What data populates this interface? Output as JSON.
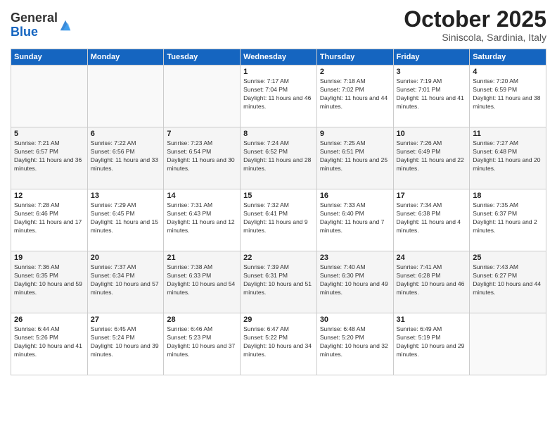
{
  "logo": {
    "general": "General",
    "blue": "Blue"
  },
  "header": {
    "month": "October 2025",
    "location": "Siniscola, Sardinia, Italy"
  },
  "days_of_week": [
    "Sunday",
    "Monday",
    "Tuesday",
    "Wednesday",
    "Thursday",
    "Friday",
    "Saturday"
  ],
  "weeks": [
    [
      {
        "day": "",
        "info": ""
      },
      {
        "day": "",
        "info": ""
      },
      {
        "day": "",
        "info": ""
      },
      {
        "day": "1",
        "info": "Sunrise: 7:17 AM\nSunset: 7:04 PM\nDaylight: 11 hours and 46 minutes."
      },
      {
        "day": "2",
        "info": "Sunrise: 7:18 AM\nSunset: 7:02 PM\nDaylight: 11 hours and 44 minutes."
      },
      {
        "day": "3",
        "info": "Sunrise: 7:19 AM\nSunset: 7:01 PM\nDaylight: 11 hours and 41 minutes."
      },
      {
        "day": "4",
        "info": "Sunrise: 7:20 AM\nSunset: 6:59 PM\nDaylight: 11 hours and 38 minutes."
      }
    ],
    [
      {
        "day": "5",
        "info": "Sunrise: 7:21 AM\nSunset: 6:57 PM\nDaylight: 11 hours and 36 minutes."
      },
      {
        "day": "6",
        "info": "Sunrise: 7:22 AM\nSunset: 6:56 PM\nDaylight: 11 hours and 33 minutes."
      },
      {
        "day": "7",
        "info": "Sunrise: 7:23 AM\nSunset: 6:54 PM\nDaylight: 11 hours and 30 minutes."
      },
      {
        "day": "8",
        "info": "Sunrise: 7:24 AM\nSunset: 6:52 PM\nDaylight: 11 hours and 28 minutes."
      },
      {
        "day": "9",
        "info": "Sunrise: 7:25 AM\nSunset: 6:51 PM\nDaylight: 11 hours and 25 minutes."
      },
      {
        "day": "10",
        "info": "Sunrise: 7:26 AM\nSunset: 6:49 PM\nDaylight: 11 hours and 22 minutes."
      },
      {
        "day": "11",
        "info": "Sunrise: 7:27 AM\nSunset: 6:48 PM\nDaylight: 11 hours and 20 minutes."
      }
    ],
    [
      {
        "day": "12",
        "info": "Sunrise: 7:28 AM\nSunset: 6:46 PM\nDaylight: 11 hours and 17 minutes."
      },
      {
        "day": "13",
        "info": "Sunrise: 7:29 AM\nSunset: 6:45 PM\nDaylight: 11 hours and 15 minutes."
      },
      {
        "day": "14",
        "info": "Sunrise: 7:31 AM\nSunset: 6:43 PM\nDaylight: 11 hours and 12 minutes."
      },
      {
        "day": "15",
        "info": "Sunrise: 7:32 AM\nSunset: 6:41 PM\nDaylight: 11 hours and 9 minutes."
      },
      {
        "day": "16",
        "info": "Sunrise: 7:33 AM\nSunset: 6:40 PM\nDaylight: 11 hours and 7 minutes."
      },
      {
        "day": "17",
        "info": "Sunrise: 7:34 AM\nSunset: 6:38 PM\nDaylight: 11 hours and 4 minutes."
      },
      {
        "day": "18",
        "info": "Sunrise: 7:35 AM\nSunset: 6:37 PM\nDaylight: 11 hours and 2 minutes."
      }
    ],
    [
      {
        "day": "19",
        "info": "Sunrise: 7:36 AM\nSunset: 6:35 PM\nDaylight: 10 hours and 59 minutes."
      },
      {
        "day": "20",
        "info": "Sunrise: 7:37 AM\nSunset: 6:34 PM\nDaylight: 10 hours and 57 minutes."
      },
      {
        "day": "21",
        "info": "Sunrise: 7:38 AM\nSunset: 6:33 PM\nDaylight: 10 hours and 54 minutes."
      },
      {
        "day": "22",
        "info": "Sunrise: 7:39 AM\nSunset: 6:31 PM\nDaylight: 10 hours and 51 minutes."
      },
      {
        "day": "23",
        "info": "Sunrise: 7:40 AM\nSunset: 6:30 PM\nDaylight: 10 hours and 49 minutes."
      },
      {
        "day": "24",
        "info": "Sunrise: 7:41 AM\nSunset: 6:28 PM\nDaylight: 10 hours and 46 minutes."
      },
      {
        "day": "25",
        "info": "Sunrise: 7:43 AM\nSunset: 6:27 PM\nDaylight: 10 hours and 44 minutes."
      }
    ],
    [
      {
        "day": "26",
        "info": "Sunrise: 6:44 AM\nSunset: 5:26 PM\nDaylight: 10 hours and 41 minutes."
      },
      {
        "day": "27",
        "info": "Sunrise: 6:45 AM\nSunset: 5:24 PM\nDaylight: 10 hours and 39 minutes."
      },
      {
        "day": "28",
        "info": "Sunrise: 6:46 AM\nSunset: 5:23 PM\nDaylight: 10 hours and 37 minutes."
      },
      {
        "day": "29",
        "info": "Sunrise: 6:47 AM\nSunset: 5:22 PM\nDaylight: 10 hours and 34 minutes."
      },
      {
        "day": "30",
        "info": "Sunrise: 6:48 AM\nSunset: 5:20 PM\nDaylight: 10 hours and 32 minutes."
      },
      {
        "day": "31",
        "info": "Sunrise: 6:49 AM\nSunset: 5:19 PM\nDaylight: 10 hours and 29 minutes."
      },
      {
        "day": "",
        "info": ""
      }
    ]
  ]
}
